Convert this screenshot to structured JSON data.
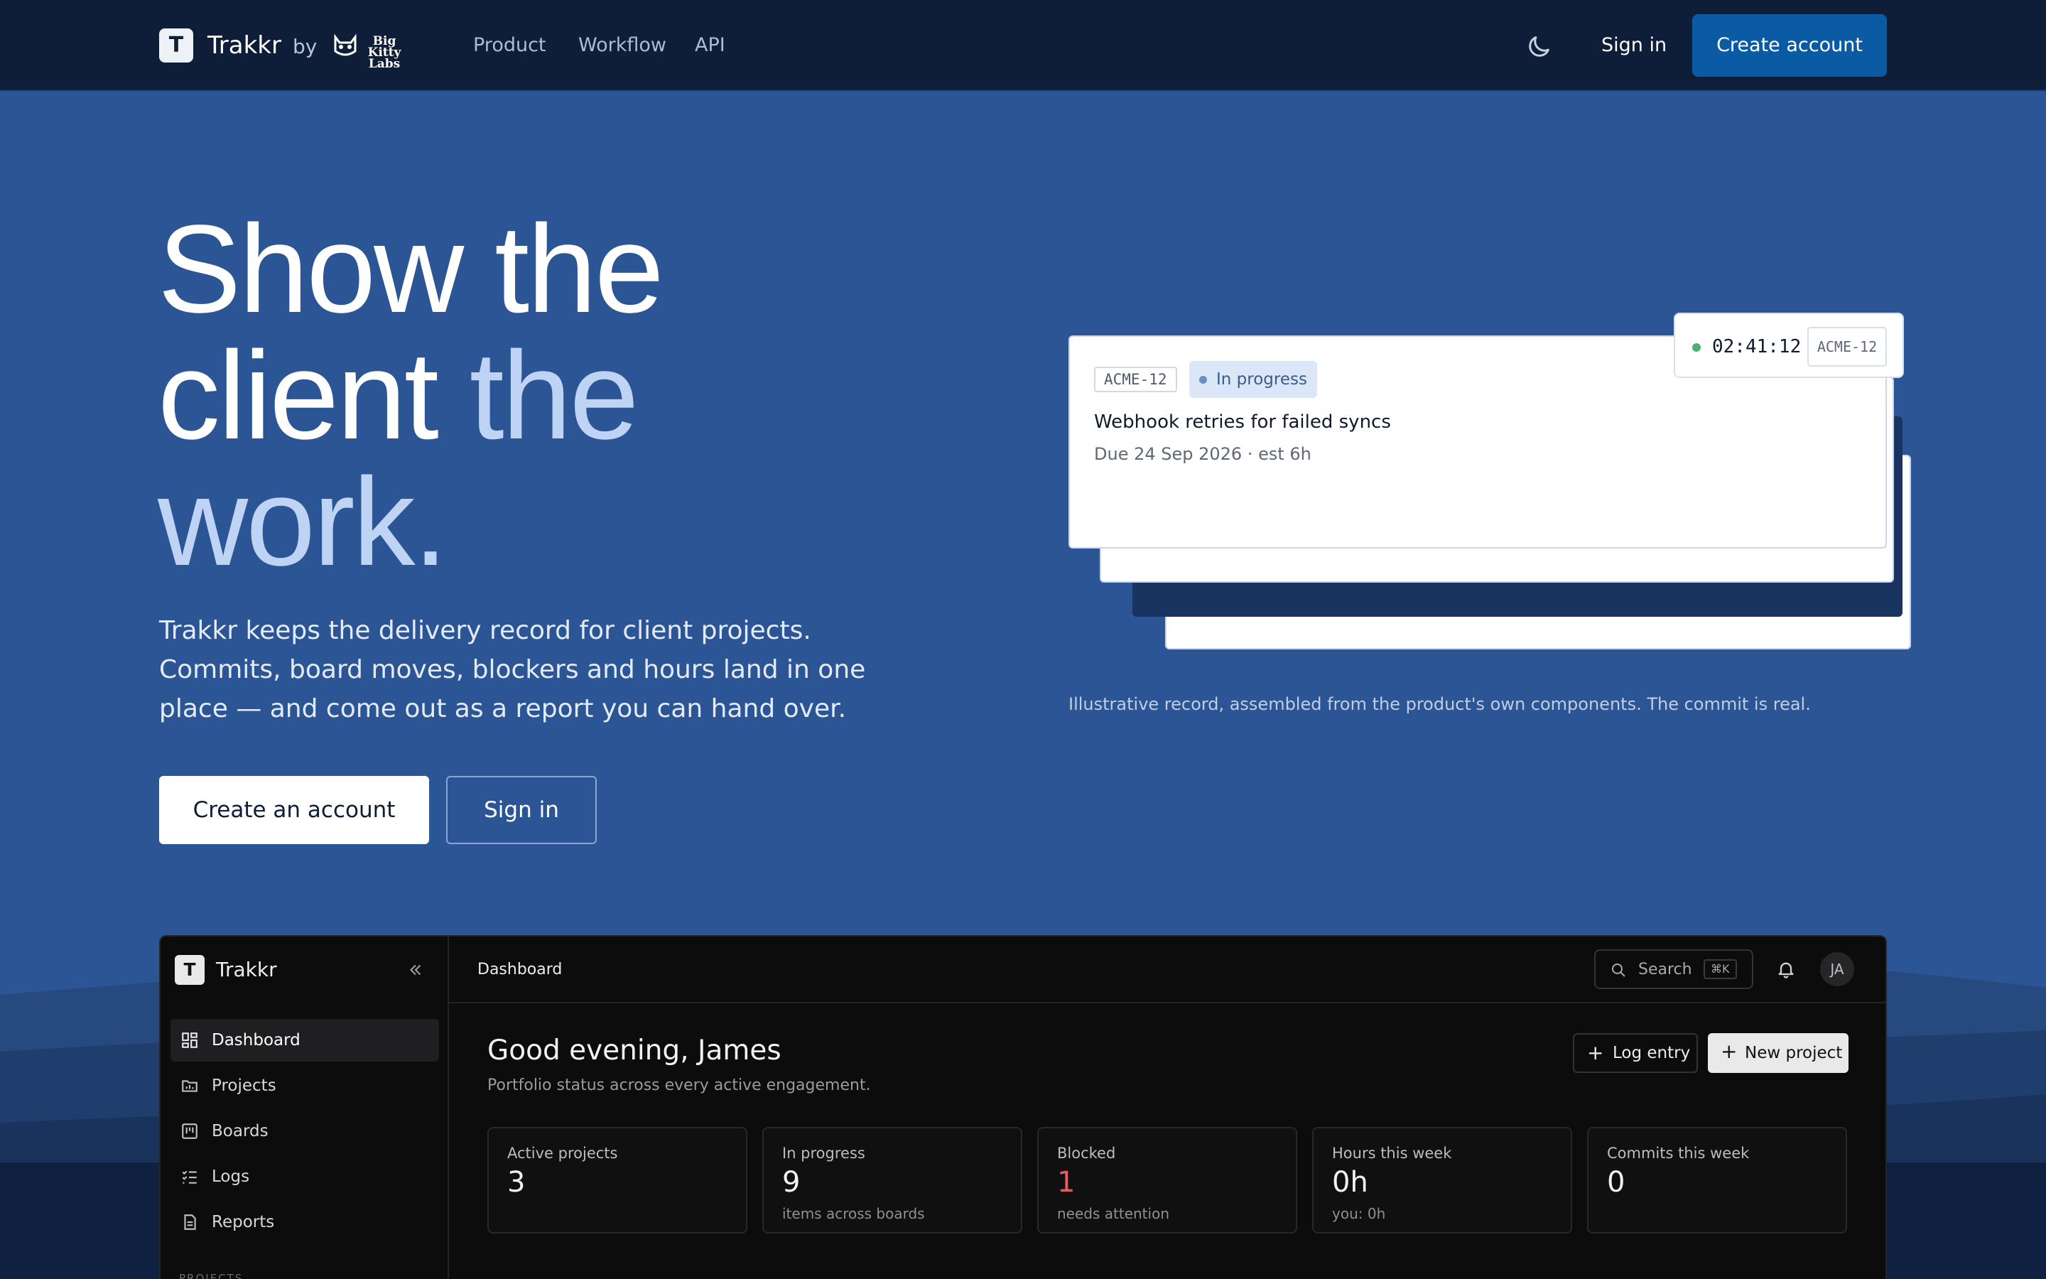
{
  "nav": {
    "brand": "Trakkr",
    "logo_letter": "T",
    "by": "by",
    "lab_name_1": "Big Kitty",
    "lab_name_2": "Labs",
    "links": [
      "Product",
      "Workflow",
      "API"
    ],
    "sign_in": "Sign in",
    "create_account": "Create account"
  },
  "hero": {
    "title_1": "Show the",
    "title_2a": "client ",
    "title_2b": "the",
    "title_3": "work.",
    "description": "Trakkr keeps the delivery record for client projects. Commits, board moves, blockers and hours land in one place — and come out as a report you can hand over.",
    "primary_cta": "Create an account",
    "secondary_cta": "Sign in"
  },
  "preview": {
    "ticket_id": "ACME-12",
    "status": "In progress",
    "title": "Webhook retries for failed syncs",
    "meta": "Due 24 Sep 2026 · est 6h",
    "timer_value": "02:41:12",
    "timer_ticket": "ACME-12",
    "note": "Illustrative record, assembled from the product's own components. The commit is real."
  },
  "app": {
    "brand": "Trakkr",
    "logo_letter": "T",
    "sidebar": [
      {
        "label": "Dashboard",
        "icon": "dashboard-icon",
        "active": true
      },
      {
        "label": "Projects",
        "icon": "folder-icon",
        "active": false
      },
      {
        "label": "Boards",
        "icon": "board-icon",
        "active": false
      },
      {
        "label": "Logs",
        "icon": "checklist-icon",
        "active": false
      },
      {
        "label": "Reports",
        "icon": "report-icon",
        "active": false
      }
    ],
    "sidebar_section": "PROJECTS",
    "breadcrumb": "Dashboard",
    "search": {
      "label": "Search",
      "shortcut": "⌘K"
    },
    "avatar": "JA",
    "greeting": "Good evening, James",
    "subtitle": "Portfolio status across every active engagement.",
    "log_entry": "Log entry",
    "new_project": "New project",
    "stats": [
      {
        "label": "Active projects",
        "value": "3",
        "sub": ""
      },
      {
        "label": "In progress",
        "value": "9",
        "sub": "items across boards"
      },
      {
        "label": "Blocked",
        "value": "1",
        "sub": "needs attention"
      },
      {
        "label": "Hours this week",
        "value": "0h",
        "sub": "you: 0h"
      },
      {
        "label": "Commits this week",
        "value": "0",
        "sub": ""
      }
    ]
  },
  "colors": {
    "hero_bg": "#2c5596",
    "nav_bg": "#0e1d38",
    "primary": "#0b5aa4",
    "accent_text": "#bfd3f5",
    "blocked": "#e65d5d"
  }
}
